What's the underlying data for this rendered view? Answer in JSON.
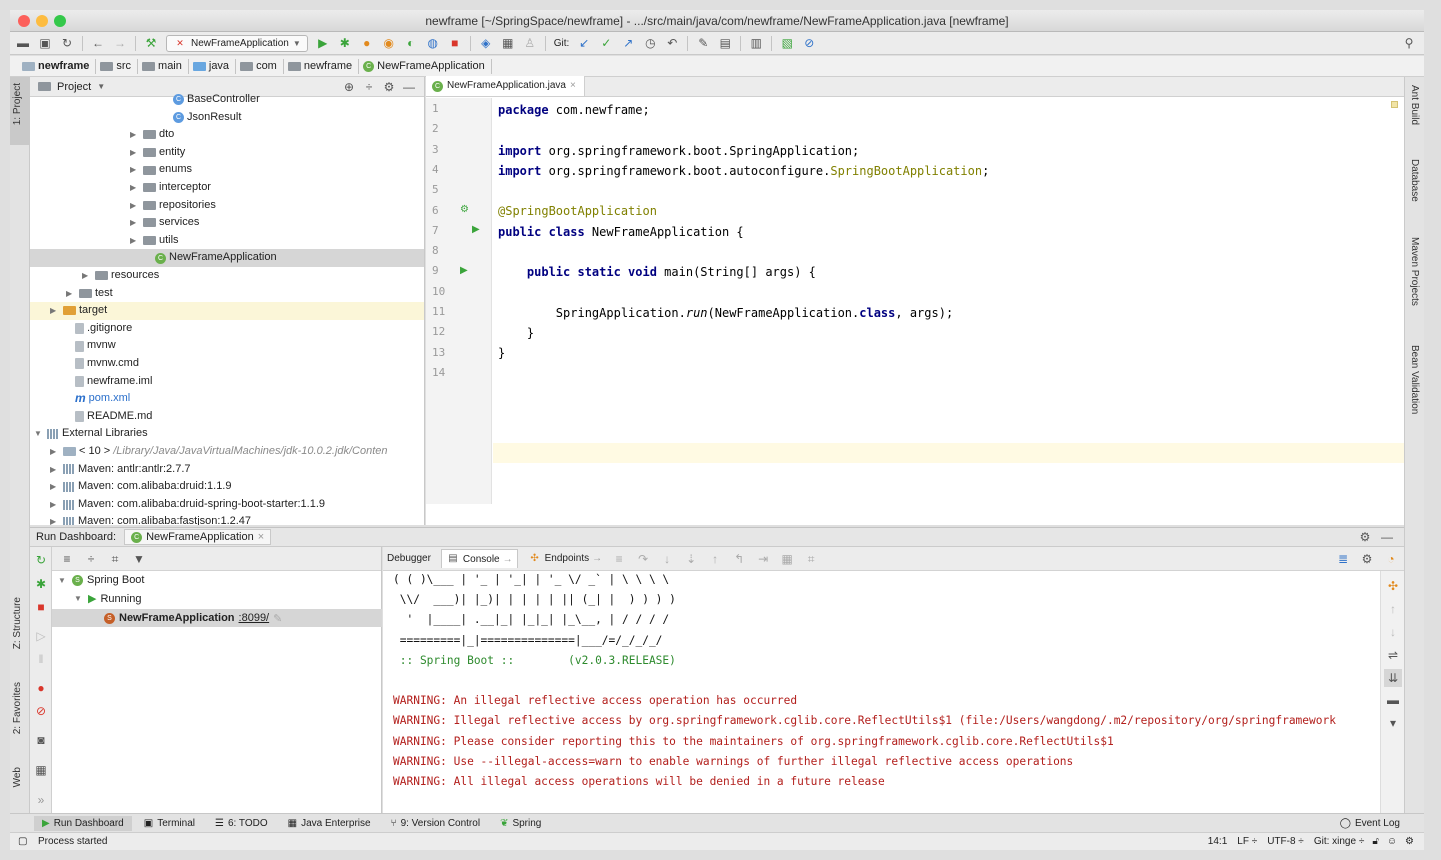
{
  "window": {
    "title": "newframe [~/SpringSpace/newframe] - .../src/main/java/com/newframe/NewFrameApplication.java [newframe]",
    "traffic_colors": [
      "#fc605b",
      "#fdbc40",
      "#34c84a"
    ]
  },
  "toolbar": {
    "run_config": "NewFrameApplication",
    "git_label": "Git:"
  },
  "breadcrumbs": [
    "newframe",
    "src",
    "main",
    "java",
    "com",
    "newframe",
    "NewFrameApplication"
  ],
  "left_strip": {
    "project": "1: Project",
    "structure": "Z: Structure",
    "favorites": "2: Favorites",
    "web": "Web"
  },
  "right_strip": {
    "ant": "Ant Build",
    "database": "Database",
    "maven": "Maven Projects",
    "bean": "Bean Validation"
  },
  "project": {
    "header_label": "Project",
    "tree": [
      {
        "label": "BaseController",
        "indent": 130,
        "icon": "class",
        "arrow": ""
      },
      {
        "label": "JsonResult",
        "indent": 130,
        "icon": "class",
        "arrow": ""
      },
      {
        "label": "dto",
        "indent": 100,
        "icon": "folder",
        "arrow": "▶"
      },
      {
        "label": "entity",
        "indent": 100,
        "icon": "folder",
        "arrow": "▶"
      },
      {
        "label": "enums",
        "indent": 100,
        "icon": "folder",
        "arrow": "▶"
      },
      {
        "label": "interceptor",
        "indent": 100,
        "icon": "folder",
        "arrow": "▶"
      },
      {
        "label": "repositories",
        "indent": 100,
        "icon": "folder",
        "arrow": "▶"
      },
      {
        "label": "services",
        "indent": 100,
        "icon": "folder",
        "arrow": "▶"
      },
      {
        "label": "utils",
        "indent": 100,
        "icon": "folder",
        "arrow": "▶"
      },
      {
        "label": "NewFrameApplication",
        "indent": 112,
        "icon": "spring",
        "arrow": "",
        "selected": true
      },
      {
        "label": "resources",
        "indent": 52,
        "icon": "folder",
        "arrow": "▶"
      },
      {
        "label": "test",
        "indent": 36,
        "icon": "folder",
        "arrow": "▶"
      },
      {
        "label": "target",
        "indent": 20,
        "icon": "folder-orange",
        "arrow": "▶",
        "highlight": true
      },
      {
        "label": ".gitignore",
        "indent": 32,
        "icon": "file",
        "arrow": ""
      },
      {
        "label": "mvnw",
        "indent": 32,
        "icon": "file",
        "arrow": ""
      },
      {
        "label": "mvnw.cmd",
        "indent": 32,
        "icon": "file",
        "arrow": ""
      },
      {
        "label": "newframe.iml",
        "indent": 32,
        "icon": "file",
        "arrow": ""
      },
      {
        "label": "pom.xml",
        "indent": 32,
        "icon": "maven",
        "arrow": ""
      },
      {
        "label": "README.md",
        "indent": 32,
        "icon": "file",
        "arrow": ""
      },
      {
        "label": "External Libraries",
        "indent": 4,
        "icon": "lib",
        "arrow": "▼"
      },
      {
        "label": "< 10 >",
        "extra": "/Library/Java/JavaVirtualMachines/jdk-10.0.2.jdk/Conten",
        "indent": 20,
        "icon": "folder-grey",
        "arrow": "▶"
      },
      {
        "label": "Maven: antlr:antlr:2.7.7",
        "indent": 20,
        "icon": "lib",
        "arrow": "▶"
      },
      {
        "label": "Maven: com.alibaba:druid:1.1.9",
        "indent": 20,
        "icon": "lib",
        "arrow": "▶"
      },
      {
        "label": "Maven: com.alibaba:druid-spring-boot-starter:1.1.9",
        "indent": 20,
        "icon": "lib",
        "arrow": "▶"
      },
      {
        "label": "Maven: com.alibaba:fastjson:1.2.47",
        "indent": 20,
        "icon": "lib",
        "arrow": "▶"
      }
    ]
  },
  "editor": {
    "tab_label": "NewFrameApplication.java",
    "line_numbers": [
      "1",
      "2",
      "3",
      "4",
      "5",
      "6",
      "7",
      "8",
      "9",
      "10",
      "11",
      "12",
      "13",
      "14"
    ]
  },
  "run_dashboard": {
    "label": "Run Dashboard:",
    "tab": "NewFrameApplication",
    "tree": {
      "root": "Spring Boot",
      "group": "Running",
      "app_name": "NewFrameApplication",
      "app_port": ":8099/"
    },
    "console_tabs": {
      "debugger": "Debugger",
      "console": "Console",
      "endpoints": "Endpoints"
    },
    "console_lines": [
      {
        "text": "( ( )\\___ | '_ | '_| | '_ \\/ _` | \\ \\ \\ \\",
        "kind": "plain"
      },
      {
        "text": " \\\\/  ___)| |_)| | | | | || (_| |  ) ) ) )",
        "kind": "plain"
      },
      {
        "text": "  '  |____| .__|_| |_|_| |_\\__, | / / / /",
        "kind": "plain"
      },
      {
        "text": " =========|_|==============|___/=/_/_/_/",
        "kind": "plain"
      },
      {
        "text": " :: Spring Boot ::        (v2.0.3.RELEASE)",
        "kind": "spring"
      },
      {
        "text": "",
        "kind": "plain"
      },
      {
        "text": "WARNING: An illegal reflective access operation has occurred",
        "kind": "warn"
      },
      {
        "text": "WARNING: Illegal reflective access by org.springframework.cglib.core.ReflectUtils$1 (file:/Users/wangdong/.m2/repository/org/springframework",
        "kind": "warn"
      },
      {
        "text": "WARNING: Please consider reporting this to the maintainers of org.springframework.cglib.core.ReflectUtils$1",
        "kind": "warn"
      },
      {
        "text": "WARNING: Use --illegal-access=warn to enable warnings of further illegal reflective access operations",
        "kind": "warn"
      },
      {
        "text": "WARNING: All illegal access operations will be denied in a future release",
        "kind": "warn"
      }
    ]
  },
  "tool_windows": [
    "Run Dashboard",
    "Terminal",
    "6: TODO",
    "Java Enterprise",
    "9: Version Control",
    "Spring"
  ],
  "event_log": "Event Log",
  "status": {
    "message": "Process started",
    "position": "14:1",
    "line_sep": "LF ÷",
    "encoding": "UTF-8 ÷",
    "git": "Git: xinge ÷"
  }
}
